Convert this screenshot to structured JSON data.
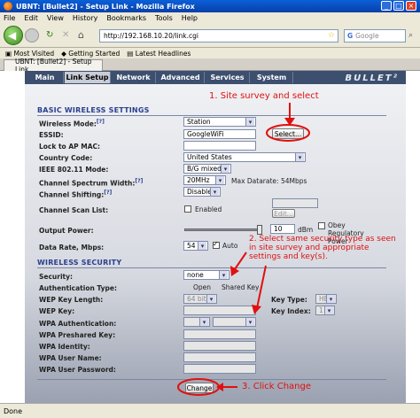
{
  "window": {
    "title": "UBNT: [Bullet2] - Setup Link - Mozilla Firefox"
  },
  "menu": [
    "File",
    "Edit",
    "View",
    "History",
    "Bookmarks",
    "Tools",
    "Help"
  ],
  "nav": {
    "url": "http://192.168.10.20/link.cgi",
    "search_placeholder": "Google"
  },
  "bookmarks": [
    "Most Visited",
    "Getting Started",
    "Latest Headlines"
  ],
  "tab": {
    "label": "UBNT: [Bullet2] - Setup Link"
  },
  "page_tabs": [
    "Main",
    "Link Setup",
    "Network",
    "Advanced",
    "Services",
    "System"
  ],
  "logo": "BULLET²",
  "basic": {
    "heading": "BASIC WIRELESS SETTINGS",
    "wireless_mode_label": "Wireless Mode:",
    "wireless_mode_value": "Station",
    "essid_label": "ESSID:",
    "essid_value": "GoogleWiFi",
    "select_button": "Select...",
    "lock_ap_label": "Lock to AP MAC:",
    "country_label": "Country Code:",
    "country_value": "United States",
    "ieee_label": "IEEE 802.11 Mode:",
    "ieee_value": "B/G mixed",
    "width_label": "Channel Spectrum Width:",
    "width_value": "20MHz",
    "max_datarate": "Max Datarate: 54Mbps",
    "shifting_label": "Channel Shifting:",
    "shifting_value": "Disabled",
    "scan_label": "Channel Scan List:",
    "scan_enabled": "Enabled",
    "edit_button": "Edit...",
    "output_label": "Output Power:",
    "output_value": "10",
    "output_unit": "dBm",
    "obey_label": "Obey Regulatory Power",
    "datarate_label": "Data Rate, Mbps:",
    "datarate_value": "54",
    "auto_label": "Auto"
  },
  "security": {
    "heading": "WIRELESS SECURITY",
    "security_label": "Security:",
    "security_value": "none",
    "auth_label": "Authentication Type:",
    "auth_open": "Open",
    "auth_shared": "Shared Key",
    "wep_len_label": "WEP Key Length:",
    "wep_len_value": "64 bit",
    "key_type_label": "Key Type:",
    "key_type_value": "HEX",
    "wep_key_label": "WEP Key:",
    "key_index_label": "Key Index:",
    "key_index_value": "1",
    "wpa_auth_label": "WPA Authentication:",
    "wpa_psk_label": "WPA Preshared Key:",
    "wpa_identity_label": "WPA Identity:",
    "wpa_user_label": "WPA User Name:",
    "wpa_pass_label": "WPA User Password:",
    "change_button": "Change"
  },
  "annotations": {
    "a1": "1. Site survey and select",
    "a2": "2. Select same security type as seen in site survey and appropriate settings and key(s).",
    "a3": "3. Click Change"
  },
  "status": "Done",
  "colors": {
    "annotation": "#e01010",
    "nav_bg": "#3d4f6f",
    "heading": "#2a3f8f"
  }
}
